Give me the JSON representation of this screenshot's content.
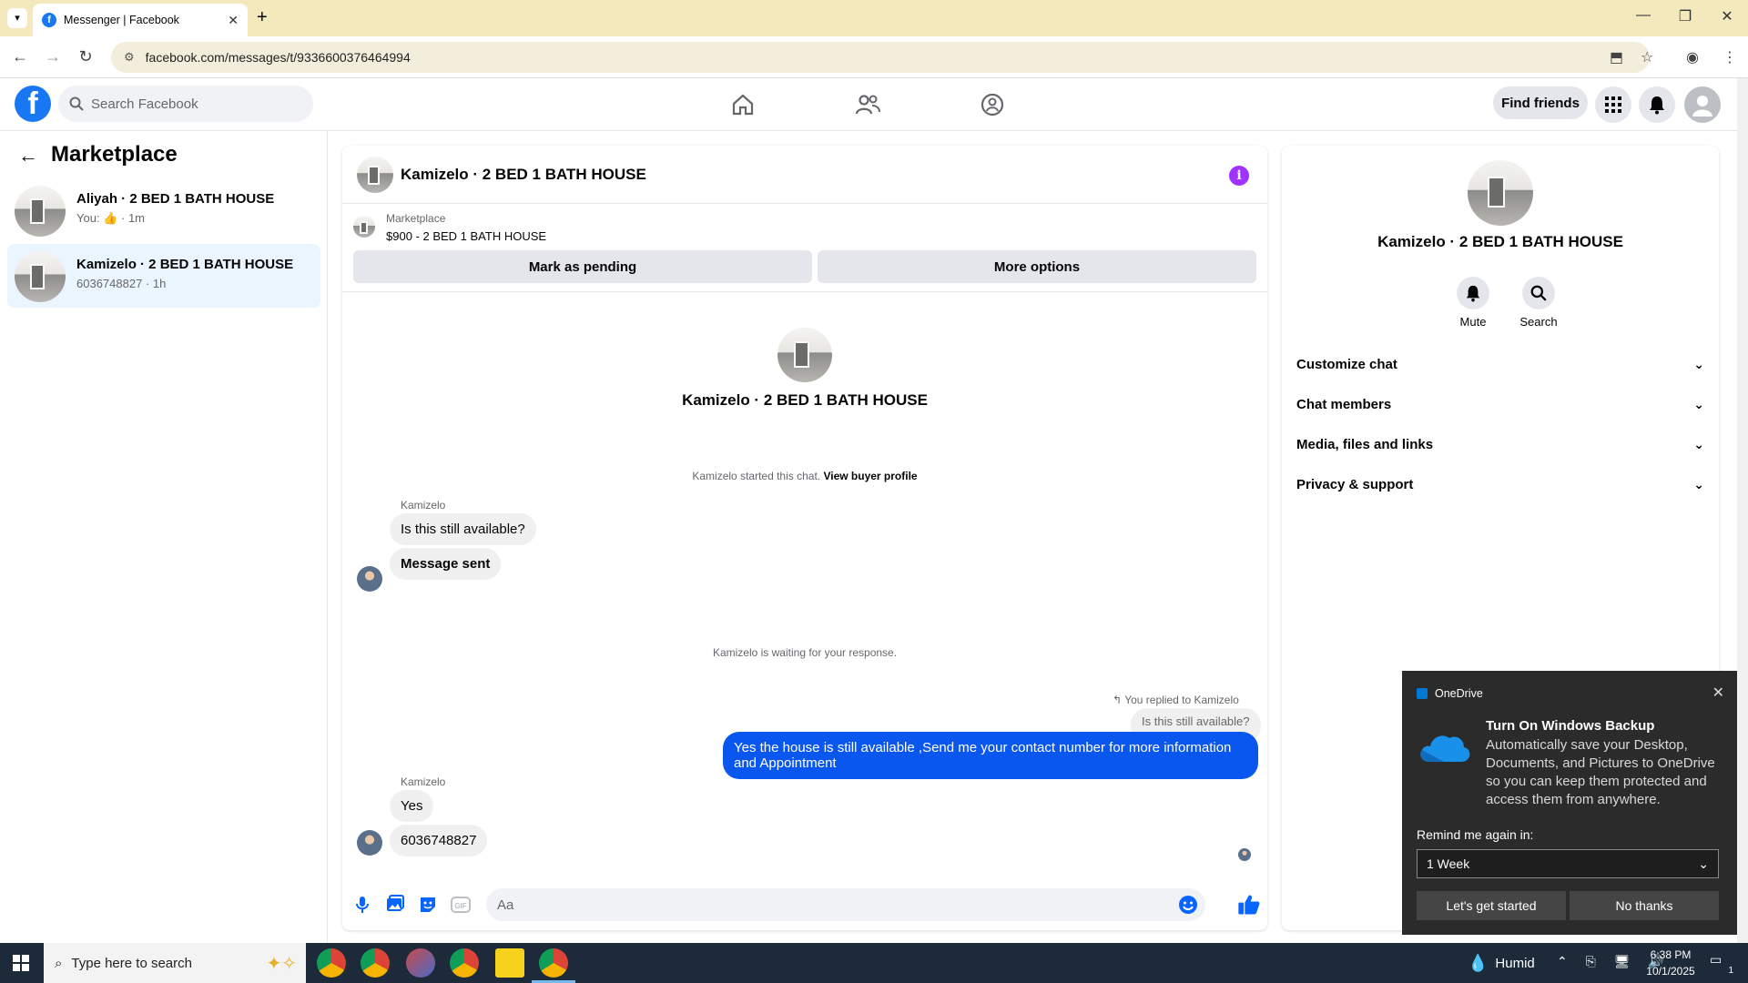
{
  "browser": {
    "tab_title": "Messenger | Facebook",
    "url": "facebook.com/messages/t/9336600376464994"
  },
  "header": {
    "search_placeholder": "Search Facebook",
    "find_friends": "Find friends"
  },
  "sidebar": {
    "title": "Marketplace",
    "conversations": [
      {
        "name": "Aliyah · 2 BED 1 BATH HOUSE",
        "sub_prefix": "You:",
        "sub_suffix": "· 1m"
      },
      {
        "name": "Kamizelo · 2 BED 1 BATH HOUSE",
        "sub": "6036748827 · 1h"
      }
    ]
  },
  "chat": {
    "title": "Kamizelo · 2 BED 1 BATH HOUSE",
    "marketplace_label": "Marketplace",
    "listing": "$900 - 2 BED 1 BATH HOUSE",
    "mark_pending": "Mark as pending",
    "more_options": "More options",
    "intro_name": "Kamizelo · 2 BED 1 BATH HOUSE",
    "started_text": "Kamizelo started this chat.",
    "view_profile": "View buyer profile",
    "sender1": "Kamizelo",
    "msg1": "Is this still available?",
    "msg2": "Message sent",
    "waiting": "Kamizelo is waiting for your response.",
    "replied_to": "You replied to Kamizelo",
    "quoted": "Is this still available?",
    "my_msg": "Yes the house is still available ,Send me your contact number for more information and Appointment",
    "sender2": "Kamizelo",
    "msg3": "Yes",
    "msg4": "6036748827",
    "input_placeholder": "Aa"
  },
  "details": {
    "name": "Kamizelo · 2 BED 1 BATH HOUSE",
    "mute": "Mute",
    "search": "Search",
    "sections": [
      "Customize chat",
      "Chat members",
      "Media, files and links",
      "Privacy & support"
    ]
  },
  "onedrive": {
    "app": "OneDrive",
    "title": "Turn On Windows Backup",
    "body": "Automatically save your Desktop, Documents, and Pictures to OneDrive so you can keep them protected and access them from anywhere.",
    "remind_label": "Remind me again in:",
    "remind_value": "1 Week",
    "start": "Let's get started",
    "no": "No thanks"
  },
  "taskbar": {
    "search_placeholder": "Type here to search",
    "weather": "Humid",
    "time": "6:38 PM",
    "date": "10/1/2025",
    "notif_count": "1"
  }
}
